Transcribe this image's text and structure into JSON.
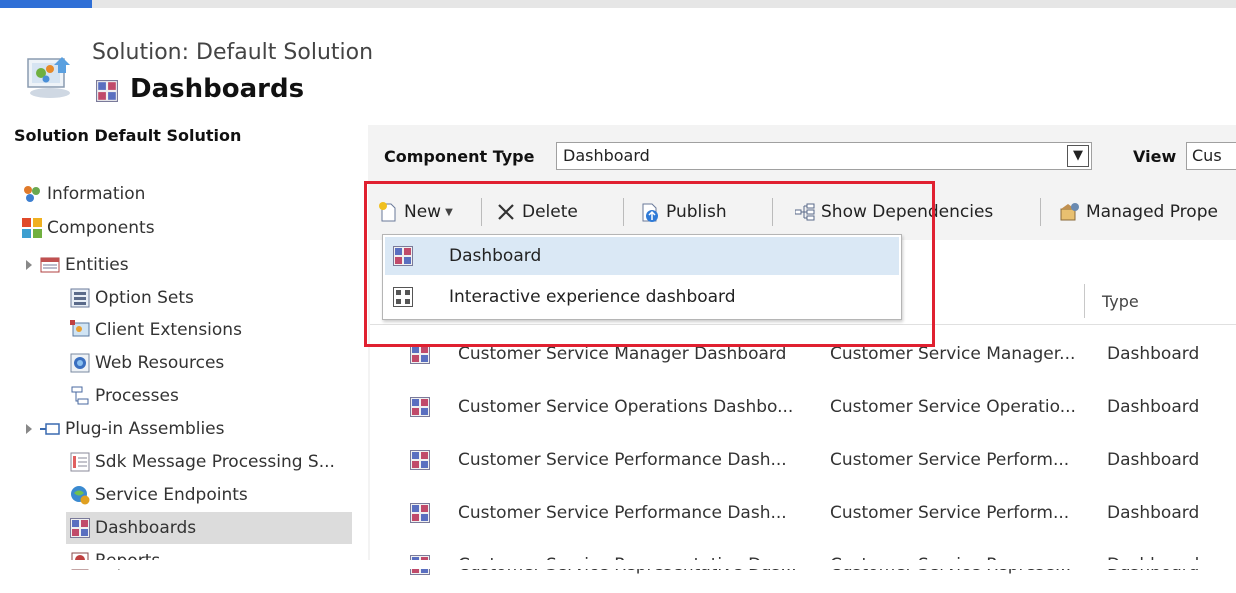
{
  "header": {
    "breadcrumb": "Solution: Default Solution",
    "title": "Dashboards",
    "icon": "solution-icon",
    "title_icon": "dashboard-icon"
  },
  "left_nav": {
    "header": "Solution Default Solution",
    "items": [
      {
        "label": "Information",
        "icon": "information-icon",
        "expandable": false,
        "selected": false
      },
      {
        "label": "Components",
        "icon": "components-icon",
        "expandable": false,
        "selected": false
      },
      {
        "label": "Entities",
        "icon": "entities-icon",
        "expandable": true,
        "selected": false
      },
      {
        "label": "Option Sets",
        "icon": "option-sets-icon",
        "expandable": false,
        "selected": false
      },
      {
        "label": "Client Extensions",
        "icon": "client-extensions-icon",
        "expandable": false,
        "selected": false
      },
      {
        "label": "Web Resources",
        "icon": "web-resources-icon",
        "expandable": false,
        "selected": false
      },
      {
        "label": "Processes",
        "icon": "processes-icon",
        "expandable": false,
        "selected": false
      },
      {
        "label": "Plug-in Assemblies",
        "icon": "plugin-assemblies-icon",
        "expandable": true,
        "selected": false
      },
      {
        "label": "Sdk Message Processing S...",
        "icon": "sdk-message-icon",
        "expandable": false,
        "selected": false
      },
      {
        "label": "Service Endpoints",
        "icon": "service-endpoints-icon",
        "expandable": false,
        "selected": false
      },
      {
        "label": "Dashboards",
        "icon": "dashboard-icon",
        "expandable": false,
        "selected": true
      },
      {
        "label": "Reports",
        "icon": "reports-icon",
        "expandable": false,
        "selected": false
      }
    ]
  },
  "filter": {
    "component_type_label": "Component Type",
    "component_type_value": "Dashboard",
    "view_label": "View",
    "view_value": "Cus"
  },
  "toolbar": {
    "new_label": "New",
    "delete_label": "Delete",
    "publish_label": "Publish",
    "show_dependencies_label": "Show Dependencies",
    "managed_properties_label": "Managed Prope"
  },
  "new_menu": {
    "items": [
      {
        "label": "Dashboard",
        "icon": "dashboard-icon",
        "highlighted": true
      },
      {
        "label": "Interactive experience dashboard",
        "icon": "interactive-dashboard-icon",
        "highlighted": false
      }
    ]
  },
  "grid": {
    "columns": [
      "",
      "",
      "Type"
    ],
    "rows": [
      {
        "name": "Customer Service Manager Dashboard",
        "display": "Customer Service Manager...",
        "type": "Dashboard"
      },
      {
        "name": "Customer Service Operations Dashbo...",
        "display": "Customer Service Operatio...",
        "type": "Dashboard"
      },
      {
        "name": "Customer Service Performance Dash...",
        "display": "Customer Service Perform...",
        "type": "Dashboard"
      },
      {
        "name": "Customer Service Performance Dash...",
        "display": "Customer Service Perform...",
        "type": "Dashboard"
      },
      {
        "name": "Customer Service Representative Das...",
        "display": "Customer Service Represe...",
        "type": "Dashboard"
      }
    ]
  },
  "colors": {
    "accent": "#2f6fd6",
    "highlight_border": "#e02030",
    "menu_hover": "#dae8f5",
    "nav_selected": "#dcdcdc"
  }
}
